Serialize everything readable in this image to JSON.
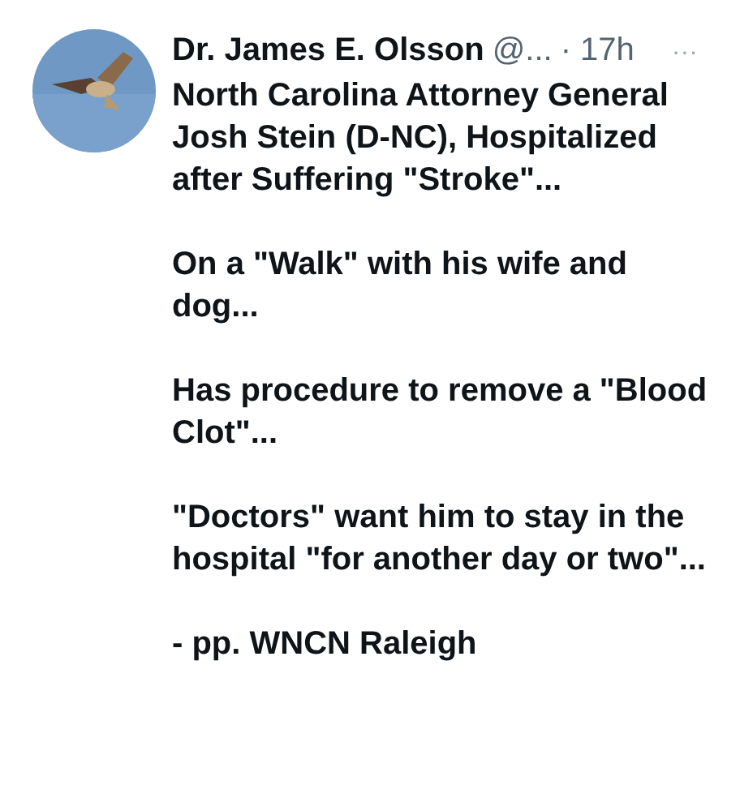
{
  "tweet": {
    "author": "Dr. James E. Olsson",
    "handle": "@...",
    "time": "· 17h",
    "more": "···",
    "paragraphs": [
      "North Carolina Attorney General Josh Stein (D-NC), Hospitalized after Suffering \"Stroke\"...",
      "On a \"Walk\" with his wife and dog...",
      "Has procedure to remove a \"Blood Clot\"...",
      "\"Doctors\" want him to stay in the hospital \"for another day or two\"...",
      "- pp. WNCN Raleigh"
    ]
  }
}
